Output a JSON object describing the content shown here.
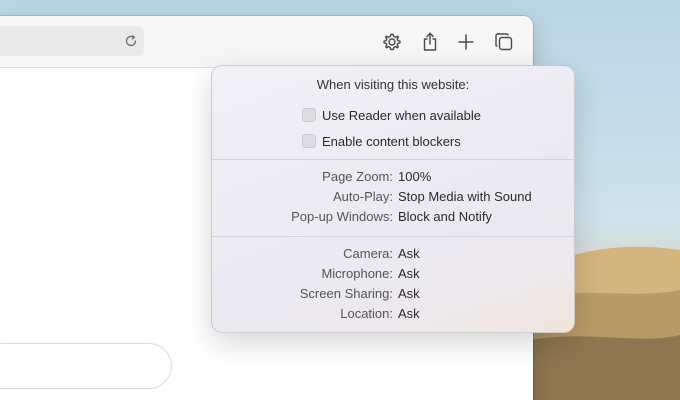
{
  "popover": {
    "title": "When visiting this website:",
    "checkboxes": [
      {
        "label": "Use Reader when available",
        "checked": false
      },
      {
        "label": "Enable content blockers",
        "checked": false
      }
    ],
    "settings_group_1": [
      {
        "label": "Page Zoom:",
        "value": "100%"
      },
      {
        "label": "Auto-Play:",
        "value": "Stop Media with Sound"
      },
      {
        "label": "Pop-up Windows:",
        "value": "Block and Notify"
      }
    ],
    "settings_group_2": [
      {
        "label": "Camera:",
        "value": "Ask"
      },
      {
        "label": "Microphone:",
        "value": "Ask"
      },
      {
        "label": "Screen Sharing:",
        "value": "Ask"
      },
      {
        "label": "Location:",
        "value": "Ask"
      }
    ]
  },
  "toolbar": {
    "icons": [
      "reload-icon",
      "gear-icon",
      "share-icon",
      "plus-icon",
      "tabs-overview-icon"
    ]
  },
  "colors": {
    "popover_bg": "#ebeaf2",
    "toolbar_bg": "#f6f6f6",
    "icon": "#4a4a4a"
  }
}
